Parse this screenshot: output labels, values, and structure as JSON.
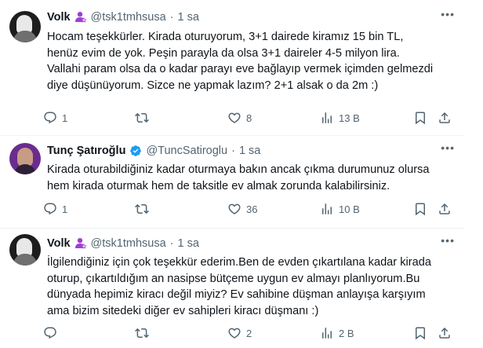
{
  "tweets": [
    {
      "name": "Volk",
      "handle": "@tsk1tmhsusa",
      "separator": "·",
      "time": "1 sa",
      "text_lines": [
        "Hocam teşekkürler. Kirada oturuyorum, 3+1 dairede kiramız 15 bin TL,",
        "henüz evim de yok. Peşin parayla da olsa 3+1 daireler 4-5 milyon lira.",
        "Vallahi param olsa da o kadar parayı eve bağlayıp vermek içimden gelmezdi",
        "diye düşünüyorum. Sizce ne yapmak lazım? 2+1 alsak o da 2m :)"
      ],
      "replies": "1",
      "retweets": "",
      "likes": "8",
      "views": "13 B"
    },
    {
      "name": "Tunç Şatıroğlu",
      "handle": "@TuncSatiroglu",
      "separator": "·",
      "time": "1 sa",
      "text_lines": [
        "Kirada oturabildiğiniz kadar oturmaya bakın ancak çıkma durumunuz olursa",
        "hem kirada oturmak hem de taksitle ev almak zorunda kalabilirsiniz."
      ],
      "replies": "1",
      "retweets": "",
      "likes": "36",
      "views": "10 B"
    },
    {
      "name": "Volk",
      "handle": "@tsk1tmhsusa",
      "separator": "·",
      "time": "1 sa",
      "text_lines": [
        "İlgilendiğiniz için çok teşekkür ederim.Ben de evden çıkartılana kadar kirada",
        "oturup, çıkartıldığım an nasipse bütçeme uygun ev almayı planlıyorum.Bu",
        "dünyada hepimiz kiracı değil miyiz? Ev sahibine düşman anlayışa karşıyım",
        "ama bizim sitedeki diğer ev sahipleri kiracı düşmanı :)"
      ],
      "replies": "",
      "retweets": "",
      "likes": "2",
      "views": "2 B"
    }
  ],
  "icons": {
    "user_badge": "person-badge-icon",
    "verified": "verified-badge-icon",
    "more": "more-icon",
    "reply": "reply-icon",
    "retweet": "retweet-icon",
    "like": "heart-icon",
    "views": "views-icon",
    "bookmark": "bookmark-icon",
    "share": "share-icon"
  },
  "colors": {
    "text": "#0f1419",
    "muted": "#536471",
    "badge_purple": "#a03fd1",
    "verified_blue": "#1d9bf0",
    "divider": "#eff3f4"
  }
}
